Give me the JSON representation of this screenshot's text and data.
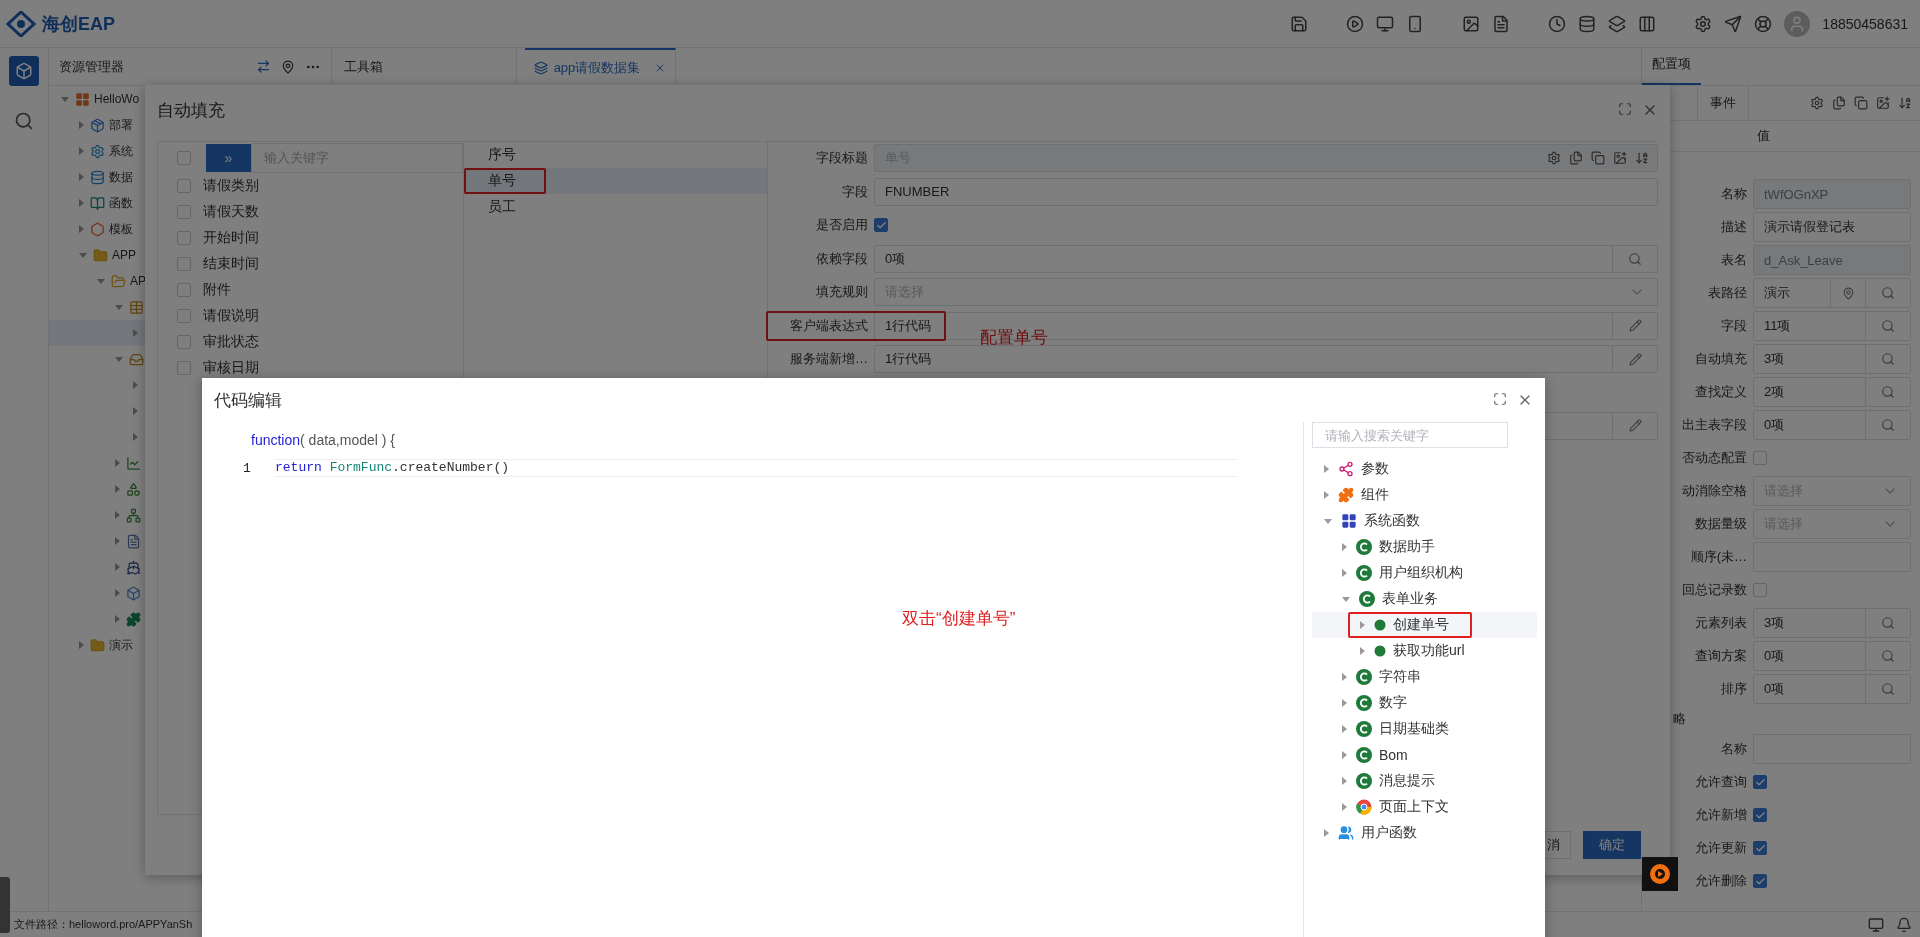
{
  "app": {
    "logo_text": "海创EAP",
    "user": "18850458631"
  },
  "explorer": {
    "title": "资源管理器",
    "tree": [
      {
        "label": "HelloWo",
        "kind": "app",
        "expanded": true,
        "selected": false,
        "children": [
          {
            "label": "部署",
            "kind": "deploy",
            "expanded": false,
            "selected": false
          },
          {
            "label": "系统",
            "kind": "gear",
            "expanded": false,
            "selected": false
          },
          {
            "label": "数据",
            "kind": "database",
            "expanded": false,
            "selected": false
          },
          {
            "label": "函数",
            "kind": "book",
            "expanded": false,
            "selected": false
          },
          {
            "label": "模板",
            "kind": "hex",
            "expanded": false,
            "selected": false
          },
          {
            "label": "APP",
            "kind": "folder",
            "expanded": true,
            "selected": false,
            "children": [
              {
                "label": "AP",
                "kind": "app-folder",
                "expanded": true,
                "selected": false,
                "children": [
                  {
                    "kind": "table",
                    "expanded": true,
                    "selected": false,
                    "children": [
                      {
                        "expanded": false,
                        "selected": true
                      }
                    ]
                  },
                  {
                    "kind": "doc-folder",
                    "expanded": true,
                    "selected": false,
                    "children": [
                      {
                        "expanded": false,
                        "selected": false
                      },
                      {
                        "expanded": false,
                        "selected": false
                      },
                      {
                        "expanded": false,
                        "selected": false
                      }
                    ]
                  },
                  {
                    "kind": "chart",
                    "expanded": false,
                    "selected": false
                  },
                  {
                    "kind": "shapes",
                    "expanded": false,
                    "selected": false
                  },
                  {
                    "kind": "hierarchy",
                    "expanded": false,
                    "selected": false
                  },
                  {
                    "kind": "doc",
                    "expanded": false,
                    "selected": false
                  },
                  {
                    "kind": "ship",
                    "expanded": false,
                    "selected": false
                  },
                  {
                    "kind": "cube",
                    "expanded": false,
                    "selected": false
                  },
                  {
                    "kind": "puzzle",
                    "expanded": false,
                    "selected": false
                  }
                ]
              }
            ]
          },
          {
            "label": "演示",
            "kind": "folder",
            "expanded": false,
            "selected": false
          }
        ]
      }
    ]
  },
  "toolbox": {
    "title": "工具箱"
  },
  "tabs": [
    {
      "label": "app请假数据集",
      "selected": true
    }
  ],
  "config_panel": {
    "title": "配置项",
    "tabs": [
      {
        "label": "事件",
        "selected": false
      }
    ],
    "column_header": "值",
    "rows": [
      {
        "label": "名称",
        "kind": "disabled",
        "value": "tWfOGnXP"
      },
      {
        "label": "描述",
        "kind": "input",
        "value": "演示请假登记表"
      },
      {
        "label": "表名",
        "kind": "disabled",
        "value": "d_Ask_Leave"
      },
      {
        "label": "表路径",
        "kind": "path",
        "value": "演示"
      },
      {
        "label": "字段",
        "kind": "lookup",
        "value": "11项"
      },
      {
        "label": "自动填充",
        "kind": "lookup",
        "value": "3项"
      },
      {
        "label": "查找定义",
        "kind": "lookup",
        "value": "2项"
      },
      {
        "label": "出主表字段",
        "kind": "lookup",
        "value": "0项"
      },
      {
        "label": "否动态配置",
        "kind": "checkbox",
        "checked": false
      },
      {
        "label": "动消除空格",
        "kind": "select",
        "placeholder": "请选择"
      },
      {
        "label": "数据量级",
        "kind": "select",
        "placeholder": "请选择"
      },
      {
        "label": "顺序(未…",
        "kind": "input"
      },
      {
        "label": "回总记录数",
        "kind": "checkbox",
        "checked": false
      },
      {
        "label": "元素列表",
        "kind": "lookup",
        "value": "3项"
      },
      {
        "label": "查询方案",
        "kind": "lookup",
        "value": "0项"
      },
      {
        "label": "排序",
        "kind": "lookup",
        "value": "0项"
      }
    ],
    "section": "略",
    "policy_rows": [
      {
        "label": "名称",
        "kind": "input"
      },
      {
        "label": "允许查询",
        "kind": "checkbox",
        "checked": true
      },
      {
        "label": "允许新增",
        "kind": "checkbox",
        "checked": true
      },
      {
        "label": "允许更新",
        "kind": "checkbox",
        "checked": true
      },
      {
        "label": "允许删除",
        "kind": "checkbox",
        "checked": true
      }
    ]
  },
  "status_bar": {
    "path": "文件路径：helloword.pro/APPYanSh"
  },
  "autofill_dialog": {
    "title": "自动填充",
    "all_checked": false,
    "move_button": "»",
    "search_placeholder": "输入关键字",
    "fields": [
      {
        "label": "请假类别",
        "checked": false
      },
      {
        "label": "请假天数",
        "checked": false
      },
      {
        "label": "开始时间",
        "checked": false
      },
      {
        "label": "结束时间",
        "checked": false
      },
      {
        "label": "附件",
        "checked": false
      },
      {
        "label": "请假说明",
        "checked": false
      },
      {
        "label": "审批状态",
        "checked": false
      },
      {
        "label": "审核日期",
        "checked": false
      }
    ],
    "chosen": [
      {
        "label": "序号",
        "selected": false,
        "marked": false
      },
      {
        "label": "单号",
        "selected": true,
        "marked": true
      },
      {
        "label": "员工",
        "selected": false,
        "marked": false
      }
    ],
    "form": [
      {
        "label": "字段标题",
        "kind": "disabled",
        "placeholder": "单号",
        "marked": false
      },
      {
        "label": "字段",
        "kind": "input",
        "value": "FNUMBER",
        "marked": false
      },
      {
        "label": "是否启用",
        "kind": "checkbox",
        "checked": true,
        "marked": false
      },
      {
        "label": "依赖字段",
        "kind": "lookup",
        "value": "0项",
        "marked": false
      },
      {
        "label": "填充规则",
        "kind": "select",
        "placeholder": "请选择",
        "marked": false
      },
      {
        "label": "客户端表达式",
        "kind": "code",
        "value": "1行代码",
        "marked": true
      },
      {
        "label": "服务端新增…",
        "kind": "code",
        "value": "1行代码",
        "marked": false
      },
      {
        "kind": "code",
        "marked": false
      }
    ],
    "annotation": "配置单号",
    "buttons": [
      {
        "label": "消",
        "kind": "secondary"
      },
      {
        "label": "确定",
        "kind": "primary"
      }
    ]
  },
  "code_dialog": {
    "title": "代码编辑",
    "signature_keyword": "function",
    "signature_rest": "( data,model ) {",
    "lines": [
      {
        "number": "1",
        "keyword": "return",
        "ident": "FormFunc",
        "rest": ".createNumber()"
      }
    ],
    "search_placeholder": "请输入搜索关键字",
    "tree": [
      {
        "label": "参数",
        "kind": "param",
        "expanded": false,
        "selected": false,
        "marked": false
      },
      {
        "label": "组件",
        "kind": "component",
        "expanded": false,
        "selected": false,
        "marked": false
      },
      {
        "label": "系统函数",
        "kind": "system",
        "expanded": true,
        "selected": false,
        "marked": false,
        "children": [
          {
            "label": "数据助手",
            "kind": "class",
            "expanded": false,
            "selected": false,
            "marked": false
          },
          {
            "label": "用户组织机构",
            "kind": "class",
            "expanded": false,
            "selected": false,
            "marked": false
          },
          {
            "label": "表单业务",
            "kind": "class",
            "expanded": true,
            "selected": false,
            "marked": false,
            "children": [
              {
                "label": "创建单号",
                "kind": "method",
                "expanded": false,
                "selected": true,
                "marked": true
              },
              {
                "label": "获取功能url",
                "kind": "method",
                "expanded": false,
                "selected": false,
                "marked": false
              }
            ]
          },
          {
            "label": "字符串",
            "kind": "class",
            "expanded": false,
            "selected": false,
            "marked": false
          },
          {
            "label": "数字",
            "kind": "class",
            "expanded": false,
            "selected": false,
            "marked": false
          },
          {
            "label": "日期基础类",
            "kind": "class",
            "expanded": false,
            "selected": false,
            "marked": false
          },
          {
            "label": "Bom",
            "kind": "class",
            "expanded": false,
            "selected": false,
            "marked": false
          },
          {
            "label": "消息提示",
            "kind": "class",
            "expanded": false,
            "selected": false,
            "marked": false
          },
          {
            "label": "页面上下文",
            "kind": "context",
            "expanded": false,
            "selected": false,
            "marked": false
          }
        ]
      },
      {
        "label": "用户函数",
        "kind": "user",
        "expanded": false,
        "selected": false,
        "marked": false
      }
    ],
    "annotation": "双击“创建单号”"
  }
}
